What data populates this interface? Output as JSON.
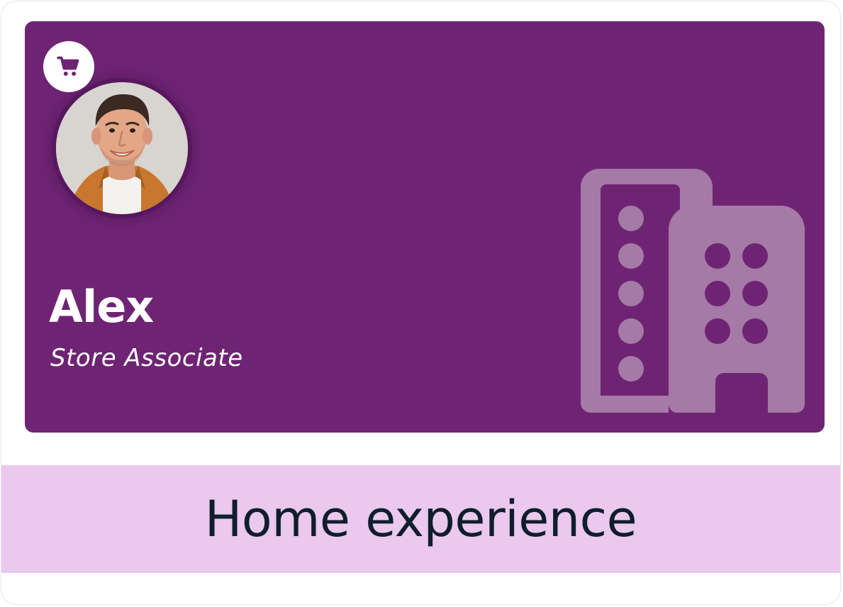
{
  "profile": {
    "name": "Alex",
    "role": "Store Associate",
    "badge_icon": "shopping-cart-icon",
    "avatar_icon": "person-avatar",
    "background_icon": "building-icon"
  },
  "footer": {
    "title": "Home experience"
  },
  "colors": {
    "hero_background": "#6e2473",
    "building_icon": "#a57aa6",
    "footer_band": "#ebc8ee",
    "footer_text": "#0f1e2d",
    "card_border": "#e6e6ea"
  }
}
